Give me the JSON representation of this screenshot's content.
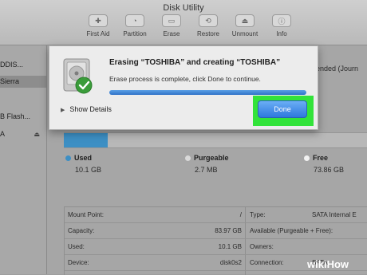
{
  "window": {
    "title": "Disk Utility"
  },
  "toolbar": {
    "items": [
      {
        "label": "First Aid",
        "icon": "stethoscope-icon"
      },
      {
        "label": "Partition",
        "icon": "partition-icon"
      },
      {
        "label": "Erase",
        "icon": "erase-icon"
      },
      {
        "label": "Restore",
        "icon": "restore-icon"
      },
      {
        "label": "Unmount",
        "icon": "unmount-icon"
      },
      {
        "label": "Info",
        "icon": "info-icon"
      }
    ]
  },
  "sidebar": {
    "items": [
      {
        "label": "DDIS..."
      },
      {
        "label": "Sierra"
      },
      {
        "label": "B Flash..."
      },
      {
        "label": "A"
      }
    ]
  },
  "main": {
    "partial_text": "ended (Journ"
  },
  "usage": {
    "used_fraction": 0.145,
    "used_color": "#3d8fc4",
    "legend": [
      {
        "label": "Used",
        "value": "10.1 GB",
        "color": "#3d8fc4"
      },
      {
        "label": "Purgeable",
        "value": "2.7 MB",
        "color": "#d9d9d9"
      },
      {
        "label": "Free",
        "value": "73.86 GB",
        "color": "#f2f2f2"
      }
    ]
  },
  "info": {
    "rows": [
      {
        "k1": "Mount Point:",
        "v1": "/",
        "k2": "Type:",
        "v2": "SATA Internal E"
      },
      {
        "k1": "Capacity:",
        "v1": "83.97 GB",
        "k2": "Available (Purgeable + Free):",
        "v2": ""
      },
      {
        "k1": "Used:",
        "v1": "10.1 GB",
        "k2": "Owners:",
        "v2": ""
      },
      {
        "k1": "Device:",
        "v1": "disk0s2",
        "k2": "Connection:",
        "v2": "SATA"
      }
    ]
  },
  "sheet": {
    "title": "Erasing “TOSHIBA” and creating “TOSHIBA”",
    "message": "Erase process is complete, click Done to continue.",
    "progress_fraction": 1.0,
    "details_label": "Show Details",
    "done_label": "Done",
    "highlight_color": "#32e33a"
  },
  "watermark": {
    "text": "wikiHow"
  }
}
